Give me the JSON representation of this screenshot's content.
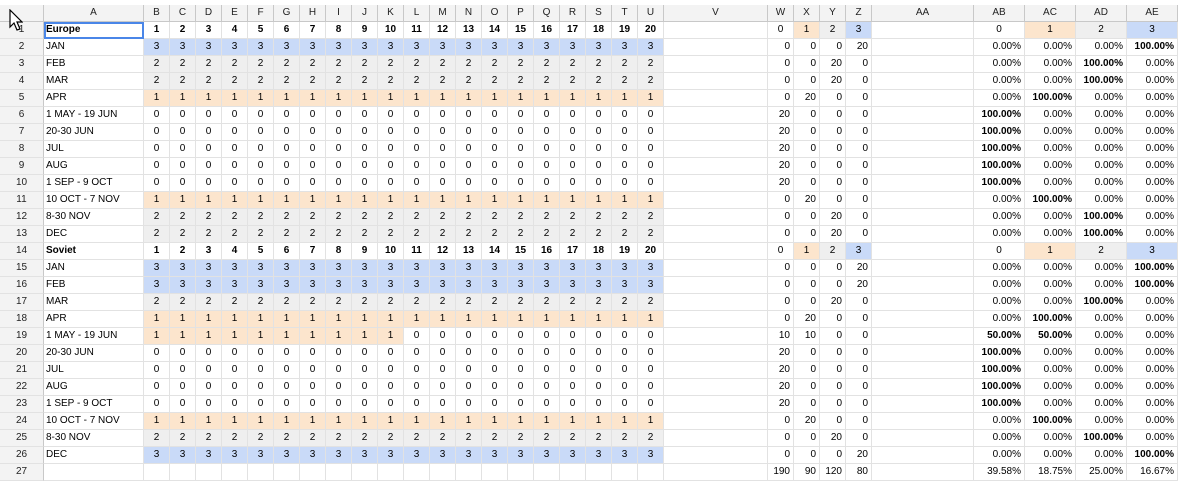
{
  "columns": [
    "A",
    "B",
    "C",
    "D",
    "E",
    "F",
    "G",
    "H",
    "I",
    "J",
    "K",
    "L",
    "M",
    "N",
    "O",
    "P",
    "Q",
    "R",
    "S",
    "T",
    "U",
    "V",
    "W",
    "X",
    "Y",
    "Z",
    "AA",
    "AB",
    "AC",
    "AD",
    "AE"
  ],
  "rows": [
    {
      "n": "1",
      "label": "Europe",
      "bold": true,
      "dayShade": "",
      "days": [
        "1",
        "2",
        "3",
        "4",
        "5",
        "6",
        "7",
        "8",
        "9",
        "10",
        "11",
        "12",
        "13",
        "14",
        "15",
        "16",
        "17",
        "18",
        "19",
        "20"
      ],
      "w": [
        "0",
        "1",
        "2",
        "3"
      ],
      "p": [
        "0",
        "1",
        "2",
        "3"
      ],
      "head": true
    },
    {
      "n": "2",
      "label": "JAN",
      "dayShade": "3",
      "days": [
        "3",
        "3",
        "3",
        "3",
        "3",
        "3",
        "3",
        "3",
        "3",
        "3",
        "3",
        "3",
        "3",
        "3",
        "3",
        "3",
        "3",
        "3",
        "3",
        "3"
      ],
      "w": [
        "0",
        "0",
        "0",
        "20"
      ],
      "p": [
        "0.00%",
        "0.00%",
        "0.00%",
        "100.00%"
      ]
    },
    {
      "n": "3",
      "label": "FEB",
      "dayShade": "2",
      "days": [
        "2",
        "2",
        "2",
        "2",
        "2",
        "2",
        "2",
        "2",
        "2",
        "2",
        "2",
        "2",
        "2",
        "2",
        "2",
        "2",
        "2",
        "2",
        "2",
        "2"
      ],
      "w": [
        "0",
        "0",
        "20",
        "0"
      ],
      "p": [
        "0.00%",
        "0.00%",
        "100.00%",
        "0.00%"
      ]
    },
    {
      "n": "4",
      "label": "MAR",
      "dayShade": "2",
      "days": [
        "2",
        "2",
        "2",
        "2",
        "2",
        "2",
        "2",
        "2",
        "2",
        "2",
        "2",
        "2",
        "2",
        "2",
        "2",
        "2",
        "2",
        "2",
        "2",
        "2"
      ],
      "w": [
        "0",
        "0",
        "20",
        "0"
      ],
      "p": [
        "0.00%",
        "0.00%",
        "100.00%",
        "0.00%"
      ]
    },
    {
      "n": "5",
      "label": "APR",
      "dayShade": "1",
      "days": [
        "1",
        "1",
        "1",
        "1",
        "1",
        "1",
        "1",
        "1",
        "1",
        "1",
        "1",
        "1",
        "1",
        "1",
        "1",
        "1",
        "1",
        "1",
        "1",
        "1"
      ],
      "w": [
        "0",
        "20",
        "0",
        "0"
      ],
      "p": [
        "0.00%",
        "100.00%",
        "0.00%",
        "0.00%"
      ]
    },
    {
      "n": "6",
      "label": "1 MAY - 19 JUN",
      "dayShade": "0",
      "days": [
        "0",
        "0",
        "0",
        "0",
        "0",
        "0",
        "0",
        "0",
        "0",
        "0",
        "0",
        "0",
        "0",
        "0",
        "0",
        "0",
        "0",
        "0",
        "0",
        "0"
      ],
      "w": [
        "20",
        "0",
        "0",
        "0"
      ],
      "p": [
        "100.00%",
        "0.00%",
        "0.00%",
        "0.00%"
      ]
    },
    {
      "n": "7",
      "label": "20-30 JUN",
      "dayShade": "0",
      "days": [
        "0",
        "0",
        "0",
        "0",
        "0",
        "0",
        "0",
        "0",
        "0",
        "0",
        "0",
        "0",
        "0",
        "0",
        "0",
        "0",
        "0",
        "0",
        "0",
        "0"
      ],
      "w": [
        "20",
        "0",
        "0",
        "0"
      ],
      "p": [
        "100.00%",
        "0.00%",
        "0.00%",
        "0.00%"
      ]
    },
    {
      "n": "8",
      "label": "JUL",
      "dayShade": "0",
      "days": [
        "0",
        "0",
        "0",
        "0",
        "0",
        "0",
        "0",
        "0",
        "0",
        "0",
        "0",
        "0",
        "0",
        "0",
        "0",
        "0",
        "0",
        "0",
        "0",
        "0"
      ],
      "w": [
        "20",
        "0",
        "0",
        "0"
      ],
      "p": [
        "100.00%",
        "0.00%",
        "0.00%",
        "0.00%"
      ]
    },
    {
      "n": "9",
      "label": "AUG",
      "dayShade": "0",
      "days": [
        "0",
        "0",
        "0",
        "0",
        "0",
        "0",
        "0",
        "0",
        "0",
        "0",
        "0",
        "0",
        "0",
        "0",
        "0",
        "0",
        "0",
        "0",
        "0",
        "0"
      ],
      "w": [
        "20",
        "0",
        "0",
        "0"
      ],
      "p": [
        "100.00%",
        "0.00%",
        "0.00%",
        "0.00%"
      ]
    },
    {
      "n": "10",
      "label": "1 SEP - 9 OCT",
      "dayShade": "0",
      "days": [
        "0",
        "0",
        "0",
        "0",
        "0",
        "0",
        "0",
        "0",
        "0",
        "0",
        "0",
        "0",
        "0",
        "0",
        "0",
        "0",
        "0",
        "0",
        "0",
        "0"
      ],
      "w": [
        "20",
        "0",
        "0",
        "0"
      ],
      "p": [
        "100.00%",
        "0.00%",
        "0.00%",
        "0.00%"
      ]
    },
    {
      "n": "11",
      "label": "10 OCT - 7 NOV",
      "dayShade": "1",
      "days": [
        "1",
        "1",
        "1",
        "1",
        "1",
        "1",
        "1",
        "1",
        "1",
        "1",
        "1",
        "1",
        "1",
        "1",
        "1",
        "1",
        "1",
        "1",
        "1",
        "1"
      ],
      "w": [
        "0",
        "20",
        "0",
        "0"
      ],
      "p": [
        "0.00%",
        "100.00%",
        "0.00%",
        "0.00%"
      ]
    },
    {
      "n": "12",
      "label": "8-30 NOV",
      "dayShade": "2",
      "days": [
        "2",
        "2",
        "2",
        "2",
        "2",
        "2",
        "2",
        "2",
        "2",
        "2",
        "2",
        "2",
        "2",
        "2",
        "2",
        "2",
        "2",
        "2",
        "2",
        "2"
      ],
      "w": [
        "0",
        "0",
        "20",
        "0"
      ],
      "p": [
        "0.00%",
        "0.00%",
        "100.00%",
        "0.00%"
      ]
    },
    {
      "n": "13",
      "label": "DEC",
      "dayShade": "2",
      "days": [
        "2",
        "2",
        "2",
        "2",
        "2",
        "2",
        "2",
        "2",
        "2",
        "2",
        "2",
        "2",
        "2",
        "2",
        "2",
        "2",
        "2",
        "2",
        "2",
        "2"
      ],
      "w": [
        "0",
        "0",
        "20",
        "0"
      ],
      "p": [
        "0.00%",
        "0.00%",
        "100.00%",
        "0.00%"
      ]
    },
    {
      "n": "14",
      "label": "Soviet",
      "bold": true,
      "dayShade": "",
      "days": [
        "1",
        "2",
        "3",
        "4",
        "5",
        "6",
        "7",
        "8",
        "9",
        "10",
        "11",
        "12",
        "13",
        "14",
        "15",
        "16",
        "17",
        "18",
        "19",
        "20"
      ],
      "w": [
        "0",
        "1",
        "2",
        "3"
      ],
      "p": [
        "0",
        "1",
        "2",
        "3"
      ],
      "head": true
    },
    {
      "n": "15",
      "label": "JAN",
      "dayShade": "3",
      "days": [
        "3",
        "3",
        "3",
        "3",
        "3",
        "3",
        "3",
        "3",
        "3",
        "3",
        "3",
        "3",
        "3",
        "3",
        "3",
        "3",
        "3",
        "3",
        "3",
        "3"
      ],
      "w": [
        "0",
        "0",
        "0",
        "20"
      ],
      "p": [
        "0.00%",
        "0.00%",
        "0.00%",
        "100.00%"
      ]
    },
    {
      "n": "16",
      "label": "FEB",
      "dayShade": "3",
      "days": [
        "3",
        "3",
        "3",
        "3",
        "3",
        "3",
        "3",
        "3",
        "3",
        "3",
        "3",
        "3",
        "3",
        "3",
        "3",
        "3",
        "3",
        "3",
        "3",
        "3"
      ],
      "w": [
        "0",
        "0",
        "0",
        "20"
      ],
      "p": [
        "0.00%",
        "0.00%",
        "0.00%",
        "100.00%"
      ]
    },
    {
      "n": "17",
      "label": "MAR",
      "dayShade": "2",
      "days": [
        "2",
        "2",
        "2",
        "2",
        "2",
        "2",
        "2",
        "2",
        "2",
        "2",
        "2",
        "2",
        "2",
        "2",
        "2",
        "2",
        "2",
        "2",
        "2",
        "2"
      ],
      "w": [
        "0",
        "0",
        "20",
        "0"
      ],
      "p": [
        "0.00%",
        "0.00%",
        "100.00%",
        "0.00%"
      ]
    },
    {
      "n": "18",
      "label": "APR",
      "dayShade": "1",
      "days": [
        "1",
        "1",
        "1",
        "1",
        "1",
        "1",
        "1",
        "1",
        "1",
        "1",
        "1",
        "1",
        "1",
        "1",
        "1",
        "1",
        "1",
        "1",
        "1",
        "1"
      ],
      "w": [
        "0",
        "20",
        "0",
        "0"
      ],
      "p": [
        "0.00%",
        "100.00%",
        "0.00%",
        "0.00%"
      ]
    },
    {
      "n": "19",
      "label": "1 MAY - 19 JUN",
      "dayShade": "mix",
      "days": [
        "1",
        "1",
        "1",
        "1",
        "1",
        "1",
        "1",
        "1",
        "1",
        "1",
        "0",
        "0",
        "0",
        "0",
        "0",
        "0",
        "0",
        "0",
        "0",
        "0"
      ],
      "w": [
        "10",
        "10",
        "0",
        "0"
      ],
      "p": [
        "50.00%",
        "50.00%",
        "0.00%",
        "0.00%"
      ]
    },
    {
      "n": "20",
      "label": "20-30 JUN",
      "dayShade": "0",
      "days": [
        "0",
        "0",
        "0",
        "0",
        "0",
        "0",
        "0",
        "0",
        "0",
        "0",
        "0",
        "0",
        "0",
        "0",
        "0",
        "0",
        "0",
        "0",
        "0",
        "0"
      ],
      "w": [
        "20",
        "0",
        "0",
        "0"
      ],
      "p": [
        "100.00%",
        "0.00%",
        "0.00%",
        "0.00%"
      ]
    },
    {
      "n": "21",
      "label": "JUL",
      "dayShade": "0",
      "days": [
        "0",
        "0",
        "0",
        "0",
        "0",
        "0",
        "0",
        "0",
        "0",
        "0",
        "0",
        "0",
        "0",
        "0",
        "0",
        "0",
        "0",
        "0",
        "0",
        "0"
      ],
      "w": [
        "20",
        "0",
        "0",
        "0"
      ],
      "p": [
        "100.00%",
        "0.00%",
        "0.00%",
        "0.00%"
      ]
    },
    {
      "n": "22",
      "label": "AUG",
      "dayShade": "0",
      "days": [
        "0",
        "0",
        "0",
        "0",
        "0",
        "0",
        "0",
        "0",
        "0",
        "0",
        "0",
        "0",
        "0",
        "0",
        "0",
        "0",
        "0",
        "0",
        "0",
        "0"
      ],
      "w": [
        "20",
        "0",
        "0",
        "0"
      ],
      "p": [
        "100.00%",
        "0.00%",
        "0.00%",
        "0.00%"
      ]
    },
    {
      "n": "23",
      "label": "1 SEP - 9 OCT",
      "dayShade": "0",
      "days": [
        "0",
        "0",
        "0",
        "0",
        "0",
        "0",
        "0",
        "0",
        "0",
        "0",
        "0",
        "0",
        "0",
        "0",
        "0",
        "0",
        "0",
        "0",
        "0",
        "0"
      ],
      "w": [
        "20",
        "0",
        "0",
        "0"
      ],
      "p": [
        "100.00%",
        "0.00%",
        "0.00%",
        "0.00%"
      ]
    },
    {
      "n": "24",
      "label": "10 OCT - 7 NOV",
      "dayShade": "1",
      "days": [
        "1",
        "1",
        "1",
        "1",
        "1",
        "1",
        "1",
        "1",
        "1",
        "1",
        "1",
        "1",
        "1",
        "1",
        "1",
        "1",
        "1",
        "1",
        "1",
        "1"
      ],
      "w": [
        "0",
        "20",
        "0",
        "0"
      ],
      "p": [
        "0.00%",
        "100.00%",
        "0.00%",
        "0.00%"
      ]
    },
    {
      "n": "25",
      "label": "8-30 NOV",
      "dayShade": "2",
      "days": [
        "2",
        "2",
        "2",
        "2",
        "2",
        "2",
        "2",
        "2",
        "2",
        "2",
        "2",
        "2",
        "2",
        "2",
        "2",
        "2",
        "2",
        "2",
        "2",
        "2"
      ],
      "w": [
        "0",
        "0",
        "20",
        "0"
      ],
      "p": [
        "0.00%",
        "0.00%",
        "100.00%",
        "0.00%"
      ]
    },
    {
      "n": "26",
      "label": "DEC",
      "dayShade": "3",
      "days": [
        "3",
        "3",
        "3",
        "3",
        "3",
        "3",
        "3",
        "3",
        "3",
        "3",
        "3",
        "3",
        "3",
        "3",
        "3",
        "3",
        "3",
        "3",
        "3",
        "3"
      ],
      "w": [
        "0",
        "0",
        "0",
        "20"
      ],
      "p": [
        "0.00%",
        "0.00%",
        "0.00%",
        "100.00%"
      ]
    }
  ],
  "totals": {
    "n": "27",
    "w": [
      "190",
      "90",
      "120",
      "80"
    ],
    "p": [
      "39.58%",
      "18.75%",
      "25.00%",
      "16.67%"
    ]
  },
  "colors": {
    "level1": "#fce5cd",
    "level2": "#efefef",
    "level3": "#c9daf8",
    "selection": "#4a86e8"
  }
}
